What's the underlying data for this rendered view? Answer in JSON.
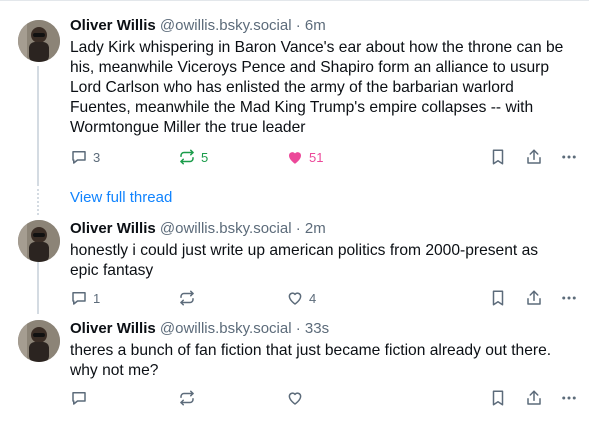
{
  "posts": [
    {
      "author": "Oliver Willis",
      "handle": "@owillis.bsky.social",
      "separator": "·",
      "time": "6m",
      "lines": [
        "Lady Kirk whispering in Baron Vance's ear about how the throne can be",
        "his, meanwhile Viceroys Pence and Shapiro form an alliance to usurp",
        "Lord Carlson who has enlisted the army of the barbarian warlord",
        "Fuentes, meanwhile the Mad King Trump's empire collapses -- with",
        "Wormtongue Miller the true leader"
      ],
      "reply_count": "3",
      "repost_count": "5",
      "like_count": "51",
      "liked": true,
      "reposted": true
    },
    {
      "author": "Oliver Willis",
      "handle": "@owillis.bsky.social",
      "separator": "·",
      "time": "2m",
      "lines": [
        "honestly i could just write up american politics from 2000-present as",
        "epic fantasy"
      ],
      "reply_count": "1",
      "repost_count": "",
      "like_count": "4",
      "liked": false,
      "reposted": false
    },
    {
      "author": "Oliver Willis",
      "handle": "@owillis.bsky.social",
      "separator": "·",
      "time": "33s",
      "lines": [
        "theres a bunch of fan fiction that just became fiction already out there.",
        "why not me?"
      ],
      "reply_count": "",
      "repost_count": "",
      "like_count": "",
      "liked": false,
      "reposted": false
    }
  ],
  "view_full_thread": "View full thread",
  "icons": {
    "reply": "reply-icon",
    "repost": "repost-icon",
    "like": "heart-icon",
    "bookmark": "bookmark-icon",
    "share": "share-icon",
    "more": "more-icon"
  },
  "colors": {
    "link": "#1083fe",
    "repost_active": "#1a9c4a",
    "like_active": "#ec4899",
    "muted": "#5c6b7a"
  }
}
